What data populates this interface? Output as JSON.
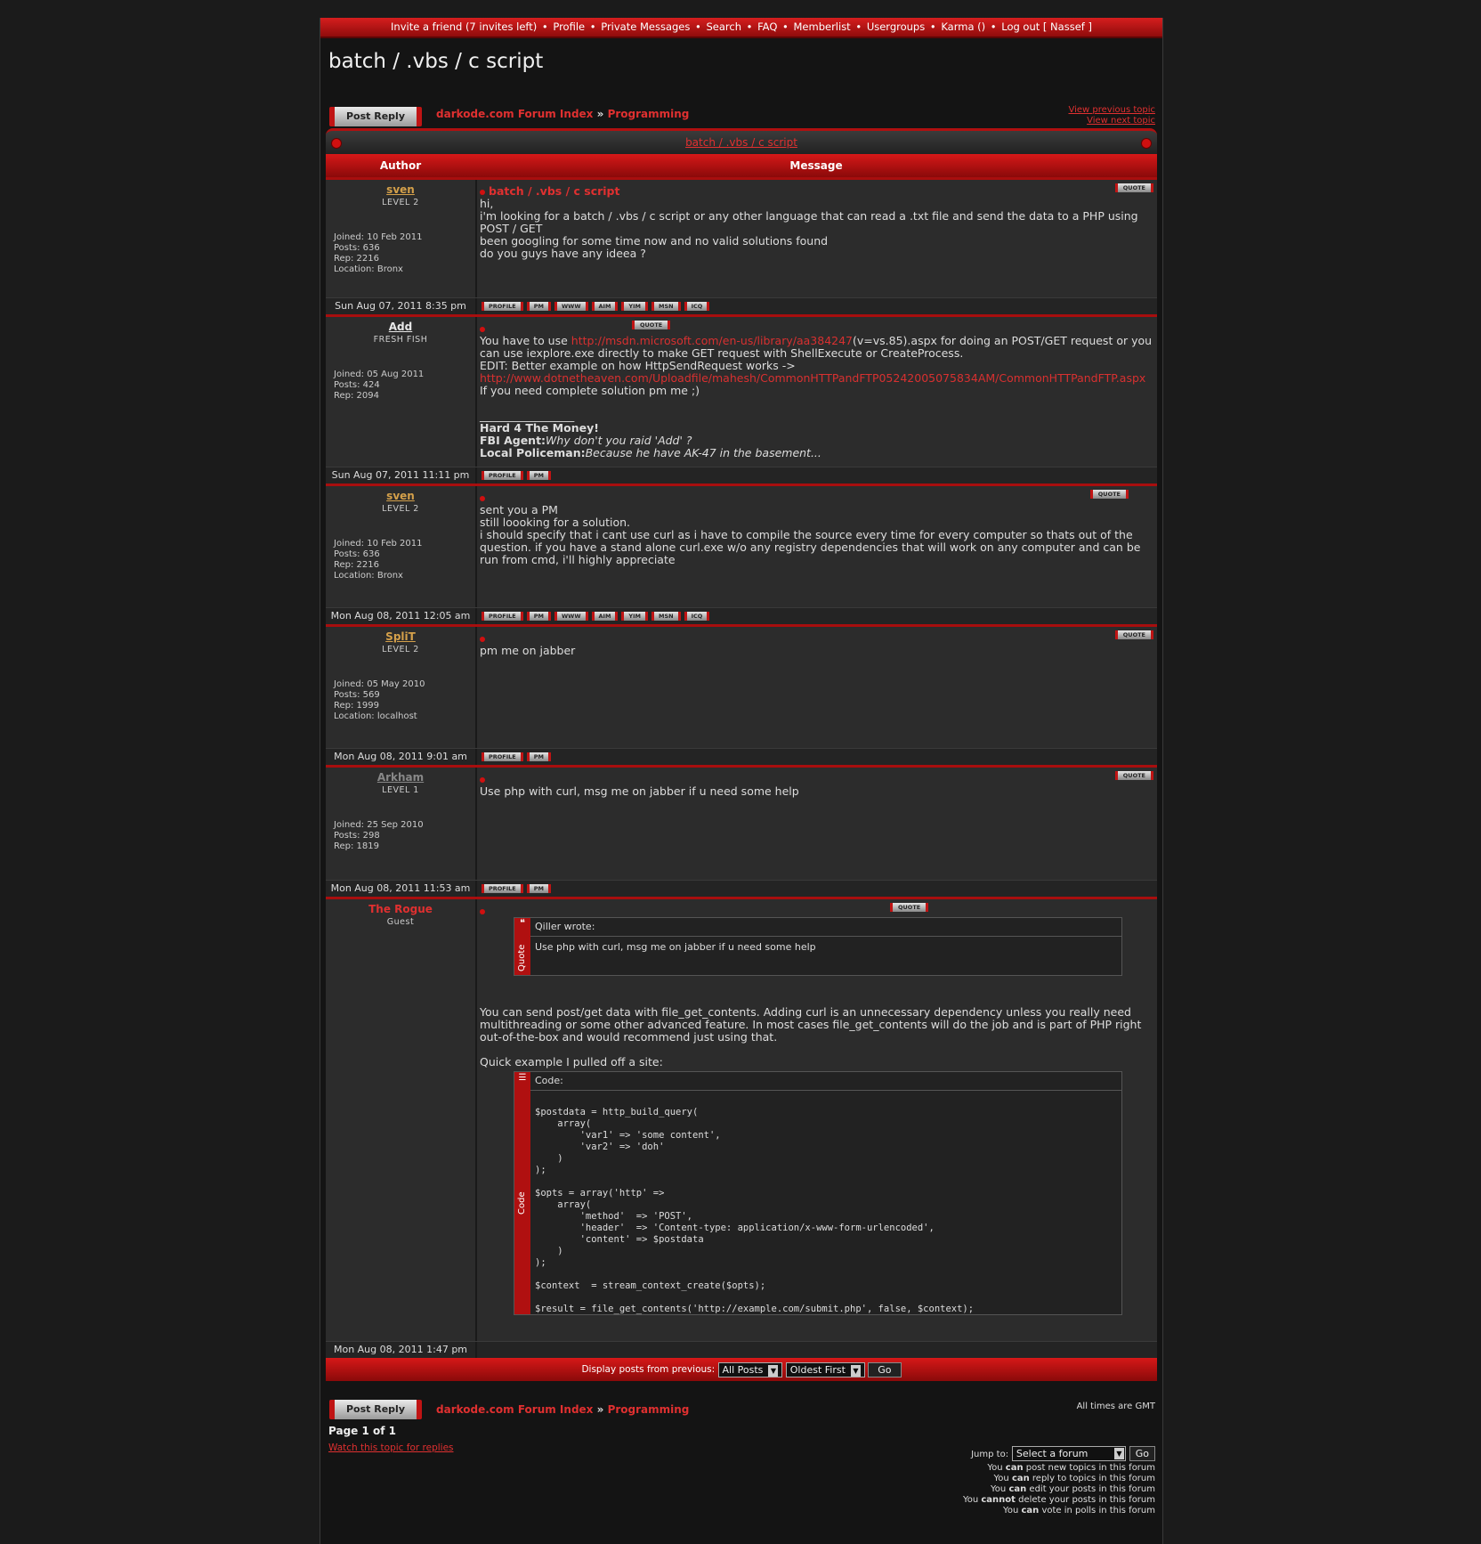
{
  "nav": {
    "items": [
      "Invite a friend (7 invites left)",
      "Profile",
      "Private Messages",
      "Search",
      "FAQ",
      "Memberlist",
      "Usergroups",
      "Karma ()",
      "Log out [ Nassef ]"
    ]
  },
  "topic_title": "batch / .vbs / c script",
  "post_reply_label": "Post Reply",
  "breadcrumb": {
    "forum_index": "darkode.com Forum Index",
    "separator": "»",
    "forum": "Programming"
  },
  "view_previous": "View previous topic",
  "view_next": "View next topic",
  "table": {
    "col_author": "Author",
    "col_message": "Message"
  },
  "buttons": {
    "quote": "QUOTE",
    "profile": "PROFILE",
    "pm": "PM",
    "www": "WWW",
    "aim": "AIM",
    "yim": "YIM",
    "msn": "MSN",
    "icq": "ICQ"
  },
  "posts": [
    {
      "author": "sven",
      "rank": "LEVEL 2",
      "joined": "Joined: 10 Feb 2011",
      "posts": "Posts: 636",
      "rep": "Rep: 2216",
      "location": "Location: Bronx",
      "title": "batch / .vbs / c script",
      "lines": [
        "hi,",
        "i'm looking for a batch / .vbs / c script or any other language that can read a .txt file and send the data to a PHP using POST / GET",
        "been googling for some time now and no valid solutions found",
        "do you guys have any ideea ?"
      ],
      "date": "Sun Aug 07, 2011 8:35 pm"
    },
    {
      "author": "Add",
      "rank": "FRESH FISH",
      "joined": "Joined: 05 Aug 2011",
      "posts": "Posts: 424",
      "rep": "Rep: 2094",
      "text_a": "You have to use ",
      "link1": "http://msdn.microsoft.com/en-us/library/aa384247",
      "text_b": "(v=vs.85).aspx for doing an POST/GET request or you can use iexplore.exe directly to make GET request with ShellExecute or CreateProcess.",
      "edit_line": "EDIT: Better example on how HttpSendRequest works ->",
      "link2": "http://www.dotnetheaven.com/Uploadfile/mahesh/CommonHTTPandFTP05242005075834AM/CommonHTTPandFTP.aspx",
      "line_last": "If you need complete solution pm me ;)",
      "sig_divider": "_________________",
      "sig1": "Hard 4 The Money!",
      "sig2_label": "FBI Agent:",
      "sig2_text": "Why don't you raid 'Add' ?",
      "sig3_label": "Local Policeman:",
      "sig3_text": "Because he have AK-47 in the basement...",
      "date": "Sun Aug 07, 2011 11:11 pm"
    },
    {
      "author": "sven",
      "rank": "LEVEL 2",
      "joined": "Joined: 10 Feb 2011",
      "posts": "Posts: 636",
      "rep": "Rep: 2216",
      "location": "Location: Bronx",
      "lines": [
        "sent you a PM",
        "still loooking for a solution.",
        "i should specify that i cant use curl as i have to compile the source every time for every computer so thats out of the question. if you have a stand alone curl.exe w/o any registry dependencies that will work on any computer and can be run from cmd, i'll highly appreciate"
      ],
      "date": "Mon Aug 08, 2011 12:05 am"
    },
    {
      "author": "SpliT",
      "rank": "LEVEL 2",
      "joined": "Joined: 05 May 2010",
      "posts": "Posts: 569",
      "rep": "Rep: 1999",
      "location": "Location: localhost",
      "lines": [
        "pm me on jabber"
      ],
      "date": "Mon Aug 08, 2011 9:01 am"
    },
    {
      "author": "Arkham",
      "rank": "LEVEL 1",
      "joined": "Joined: 25 Sep 2010",
      "posts": "Posts: 298",
      "rep": "Rep: 1819",
      "lines": [
        "Use php with curl, msg me on jabber if u need some help"
      ],
      "date": "Mon Aug 08, 2011 11:53 am"
    },
    {
      "author": "The Rogue",
      "rank": "Guest",
      "quote_head": "Qiller wrote:",
      "quote_label": "Quote",
      "quote_body": "Use php with curl, msg me on jabber if u need some help",
      "para1": "You can send post/get data with file_get_contents. Adding curl is an unnecessary dependency unless you really need multithreading or some other advanced feature. In most cases file_get_contents will do the job and is part of PHP right out-of-the-box and would recommend just using that.",
      "para2": "Quick example I pulled off a site:",
      "code_head": "Code:",
      "code_label": "Code",
      "code": "\n$postdata = http_build_query(\n    array(\n        'var1' => 'some content',\n        'var2' => 'doh'\n    )\n);\n\n$opts = array('http' =>\n    array(\n        'method'  => 'POST',\n        'header'  => 'Content-type: application/x-www-form-urlencoded',\n        'content' => $postdata\n    )\n);\n\n$context  = stream_context_create($opts);\n\n$result = file_get_contents('http://example.com/submit.php', false, $context);",
      "date": "Mon Aug 08, 2011 1:47 pm"
    }
  ],
  "display": {
    "label": "Display posts from previous:",
    "posts_select": "All Posts",
    "order_select": "Oldest First",
    "go": "Go"
  },
  "all_times": "All times are GMT",
  "page_info": "Page 1 of 1",
  "watch_topic": "Watch this topic for replies",
  "jump": {
    "label": "Jump to:",
    "select": "Select a forum",
    "go": "Go"
  },
  "permissions": [
    {
      "a": "You ",
      "b": "can",
      "c": " post new topics in this forum"
    },
    {
      "a": "You ",
      "b": "can",
      "c": " reply to topics in this forum"
    },
    {
      "a": "You ",
      "b": "can",
      "c": " edit your posts in this forum"
    },
    {
      "a": "You ",
      "b": "cannot",
      "c": " delete your posts in this forum"
    },
    {
      "a": "You ",
      "b": "can",
      "c": " vote in polls in this forum"
    }
  ]
}
